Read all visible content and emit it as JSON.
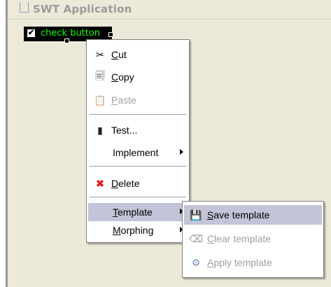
{
  "window": {
    "title": "SWT Application"
  },
  "widget": {
    "label": "check button",
    "checked": true,
    "check_mark": "✔"
  },
  "context_menu": {
    "items": [
      {
        "key": "C",
        "rest": "ut",
        "icon": "scissors-icon",
        "glyph": "✂",
        "enabled": true
      },
      {
        "key": "C",
        "rest": "opy",
        "icon": "copy-icon",
        "glyph": "🗐",
        "enabled": true
      },
      {
        "key": "P",
        "rest": "aste",
        "icon": "paste-icon",
        "glyph": "📋",
        "enabled": false
      },
      {
        "label": "Test...",
        "icon": "test-icon",
        "glyph": "▮",
        "enabled": true
      },
      {
        "label": "Implement",
        "submenu": true,
        "enabled": true
      },
      {
        "key": "D",
        "rest": "elete",
        "icon": "delete-icon",
        "glyph": "✖",
        "enabled": true
      },
      {
        "key": "T",
        "rest": "emplate",
        "submenu": true,
        "enabled": true,
        "highlighted": true
      },
      {
        "key": "M",
        "rest": "orphing",
        "submenu": true,
        "enabled": true
      }
    ]
  },
  "template_submenu": {
    "items": [
      {
        "key": "S",
        "rest": "ave template",
        "icon": "save-icon",
        "glyph": "💾",
        "enabled": true,
        "highlighted": true
      },
      {
        "key": "C",
        "rest": "lear template",
        "icon": "eraser-icon",
        "glyph": "⌫",
        "enabled": false
      },
      {
        "key": "A",
        "rest": "pply template",
        "icon": "apply-icon",
        "glyph": "⚙",
        "enabled": false
      }
    ]
  },
  "colors": {
    "selection_bg": "#000000",
    "selection_text": "#00ff00",
    "menu_highlight": "#c4c4d8",
    "disabled_text": "#a0a0a0",
    "delete_icon": "#e02020"
  }
}
